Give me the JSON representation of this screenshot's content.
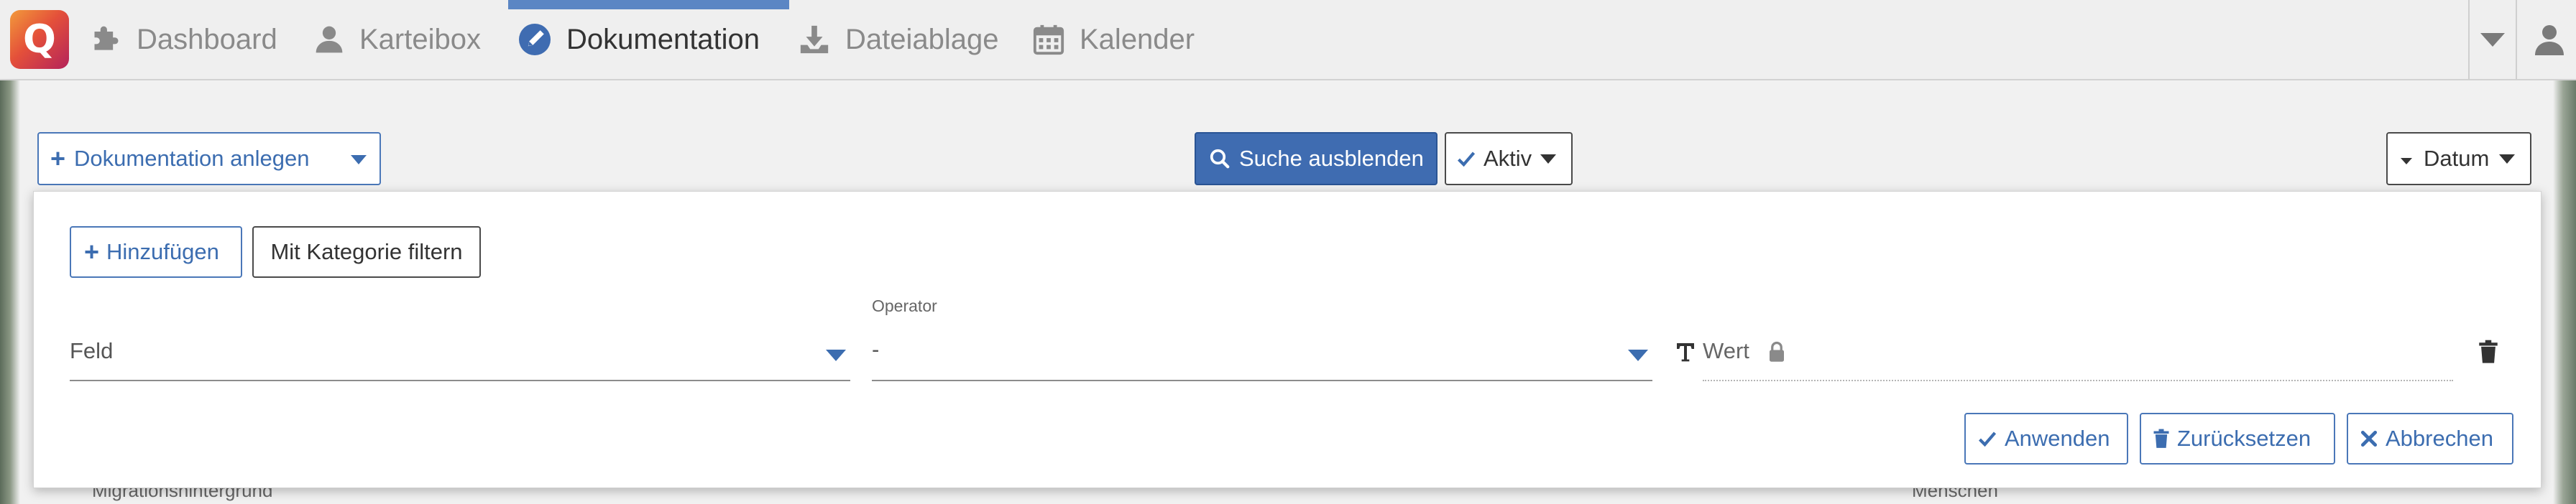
{
  "app": {
    "logo_letter": "Q",
    "nav": [
      {
        "label": "Dashboard",
        "icon": "puzzle-icon"
      },
      {
        "label": "Karteibox",
        "icon": "user-icon"
      },
      {
        "label": "Dokumentation",
        "icon": "pen-icon",
        "active": true
      },
      {
        "label": "Dateiablage",
        "icon": "download-icon"
      },
      {
        "label": "Kalender",
        "icon": "calendar-icon"
      }
    ],
    "accent_color": "#5b86c4"
  },
  "toolbar": {
    "create_label": "Dokumentation anlegen",
    "hide_search_label": "Suche ausblenden",
    "active_label": "Aktiv",
    "sort_label": "Datum"
  },
  "filter_panel": {
    "add_label": "Hinzufügen",
    "category_filter_label": "Mit Kategorie filtern",
    "field_placeholder": "Feld",
    "operator_label": "Operator",
    "operator_value": "-",
    "value_placeholder": "Wert",
    "apply_label": "Anwenden",
    "reset_label": "Zurücksetzen",
    "cancel_label": "Abbrechen"
  },
  "background": {
    "left_text": "Migrationshintergrund",
    "right_text": "Menschen"
  }
}
